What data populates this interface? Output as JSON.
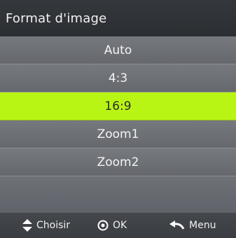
{
  "header": {
    "title": "Format d'image"
  },
  "menu": {
    "items": [
      {
        "label": "Auto",
        "selected": false
      },
      {
        "label": "4:3",
        "selected": false
      },
      {
        "label": "16:9",
        "selected": true
      },
      {
        "label": "Zoom1",
        "selected": false
      },
      {
        "label": "Zoom2",
        "selected": false
      }
    ]
  },
  "footer": {
    "select_label": "Choisir",
    "select_icon": "up-down-arrows-icon",
    "ok_label": "OK",
    "ok_icon": "ok-circle-icon",
    "menu_label": "Menu",
    "menu_icon": "return-arrow-icon"
  },
  "colors": {
    "highlight": "#b9f514",
    "header": "#2f3236"
  }
}
